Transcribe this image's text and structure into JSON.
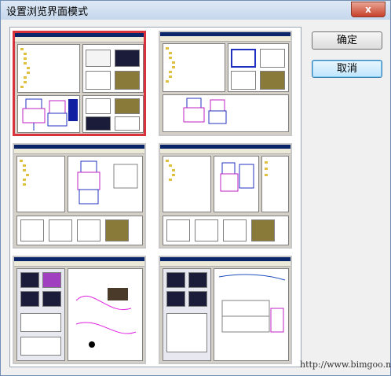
{
  "window": {
    "title": "设置浏览界面模式",
    "close_glyph": "x"
  },
  "buttons": {
    "ok": "确定",
    "cancel": "取消"
  },
  "layouts": [
    {
      "name": "layout-1",
      "selected": true
    },
    {
      "name": "layout-2",
      "selected": false
    },
    {
      "name": "layout-3",
      "selected": false
    },
    {
      "name": "layout-4",
      "selected": false
    },
    {
      "name": "layout-5",
      "selected": false
    },
    {
      "name": "layout-6",
      "selected": false
    }
  ],
  "watermark": "http://www.bimgoo.net",
  "colors": {
    "selection_border": "#d8323c",
    "app_titlebar": "#0a246a",
    "cad_blue": "#2030c0",
    "cad_magenta": "#c020c0"
  }
}
